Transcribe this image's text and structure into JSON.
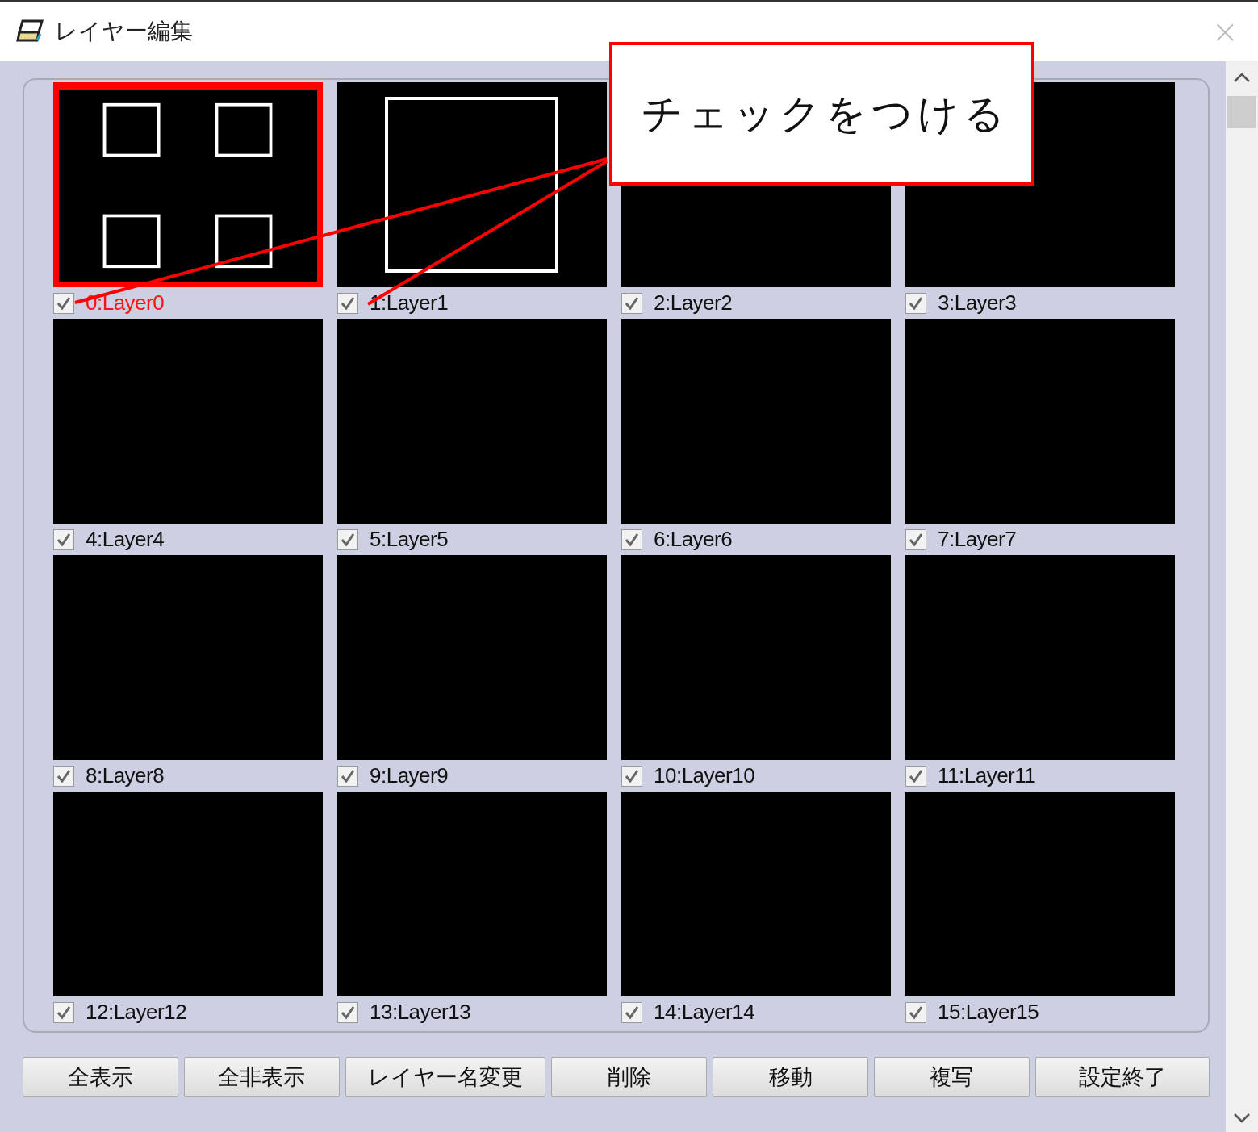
{
  "window": {
    "title": "レイヤー編集",
    "close": "×"
  },
  "layers": [
    {
      "label": "0:Layer0",
      "checked": true,
      "selected": true,
      "kind": "four-squares"
    },
    {
      "label": "1:Layer1",
      "checked": true,
      "selected": false,
      "kind": "rectangle"
    },
    {
      "label": "2:Layer2",
      "checked": true,
      "selected": false,
      "kind": "empty"
    },
    {
      "label": "3:Layer3",
      "checked": true,
      "selected": false,
      "kind": "empty"
    },
    {
      "label": "4:Layer4",
      "checked": true,
      "selected": false,
      "kind": "empty"
    },
    {
      "label": "5:Layer5",
      "checked": true,
      "selected": false,
      "kind": "empty"
    },
    {
      "label": "6:Layer6",
      "checked": true,
      "selected": false,
      "kind": "empty"
    },
    {
      "label": "7:Layer7",
      "checked": true,
      "selected": false,
      "kind": "empty"
    },
    {
      "label": "8:Layer8",
      "checked": true,
      "selected": false,
      "kind": "empty"
    },
    {
      "label": "9:Layer9",
      "checked": true,
      "selected": false,
      "kind": "empty"
    },
    {
      "label": "10:Layer10",
      "checked": true,
      "selected": false,
      "kind": "empty"
    },
    {
      "label": "11:Layer11",
      "checked": true,
      "selected": false,
      "kind": "empty"
    },
    {
      "label": "12:Layer12",
      "checked": true,
      "selected": false,
      "kind": "empty"
    },
    {
      "label": "13:Layer13",
      "checked": true,
      "selected": false,
      "kind": "empty"
    },
    {
      "label": "14:Layer14",
      "checked": true,
      "selected": false,
      "kind": "empty"
    },
    {
      "label": "15:Layer15",
      "checked": true,
      "selected": false,
      "kind": "empty"
    }
  ],
  "buttons": [
    "全表示",
    "全非表示",
    "レイヤー名変更",
    "削除",
    "移動",
    "複写",
    "設定終了"
  ],
  "callout": {
    "text": "チェックをつける"
  }
}
